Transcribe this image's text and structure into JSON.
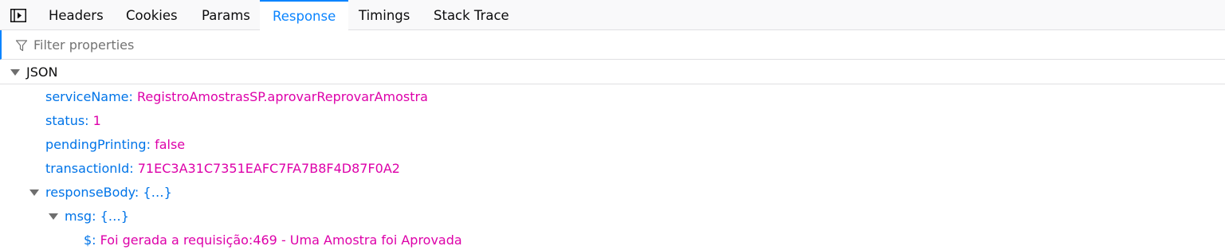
{
  "tabs": {
    "headers": "Headers",
    "cookies": "Cookies",
    "params": "Params",
    "response": "Response",
    "timings": "Timings",
    "stack_trace": "Stack Trace",
    "active": "Response"
  },
  "filter": {
    "placeholder": "Filter properties"
  },
  "tree": {
    "root_label": "JSON",
    "rows": [
      {
        "key": "serviceName:",
        "value": "RegistroAmostrasSP.aprovarReprovarAmostra"
      },
      {
        "key": "status:",
        "value": "1"
      },
      {
        "key": "pendingPrinting:",
        "value": "false"
      },
      {
        "key": "transactionId:",
        "value": "71EC3A31C7351EAFC7FA7B8F4D87F0A2"
      }
    ],
    "response_body": {
      "key": "responseBody:",
      "summary": "{…}"
    },
    "msg": {
      "key": "msg:",
      "summary": "{…}"
    },
    "dollar": {
      "key": "$:",
      "value": "Foi gerada a requisição:469 - Uma Amostra foi Aprovada"
    }
  },
  "colors": {
    "accent": "#0a84ff",
    "key": "#0074e8",
    "value": "#dd00a9"
  }
}
